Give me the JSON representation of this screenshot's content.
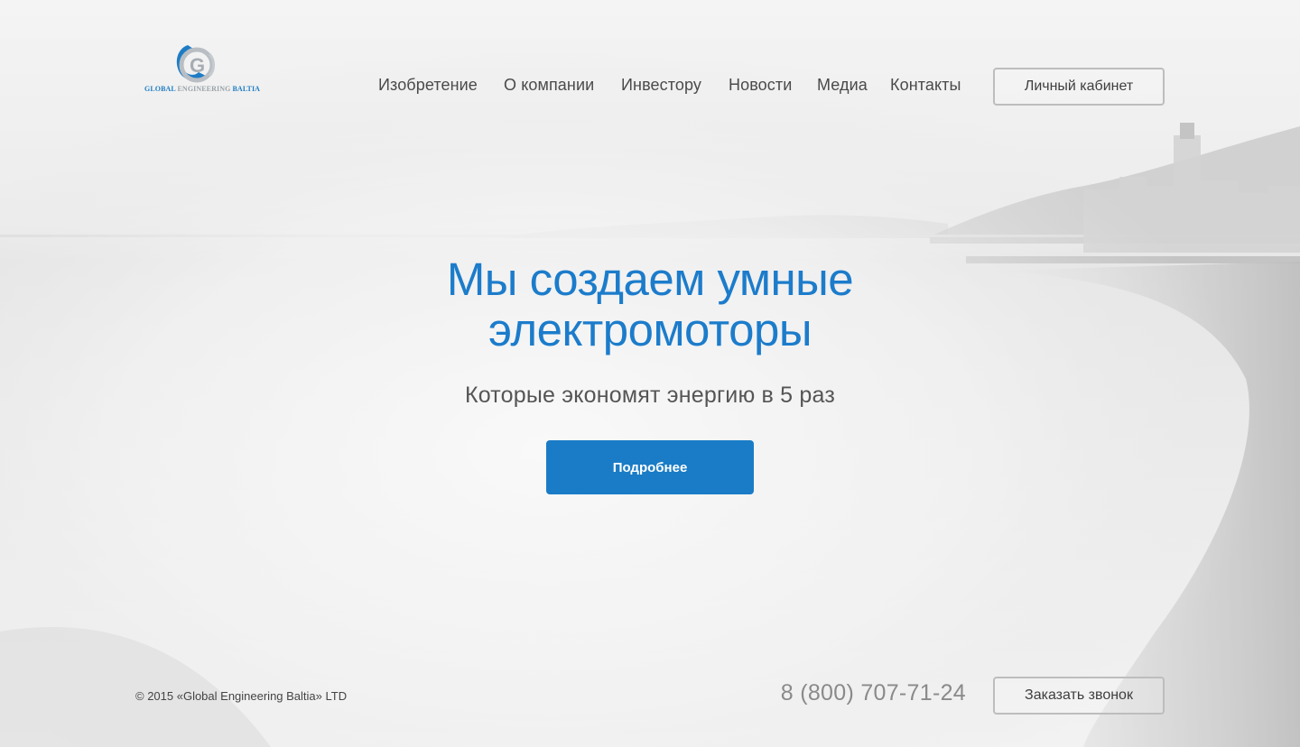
{
  "logo": {
    "icon": "global-engineering-baltia-logo",
    "text_blue": "GLOBAL ",
    "text_grey": "ENGINEERING ",
    "text_blue2": "BALTIA",
    "colors": {
      "blue": "#1e7cc4",
      "grey": "#9aa2a8"
    }
  },
  "nav": {
    "items": [
      {
        "label": "Изобретение"
      },
      {
        "label": "О компании"
      },
      {
        "label": "Инвестору"
      },
      {
        "label": "Новости"
      },
      {
        "label": "Медиа"
      },
      {
        "label": "Контакты"
      }
    ],
    "cabinet_label": "Личный кабинет"
  },
  "hero": {
    "title_line1": "Мы создаем умные",
    "title_line2": "электромоторы",
    "subtitle": "Которые экономят энергию в 5 раз",
    "button_label": "Подробнее"
  },
  "footer": {
    "copyright": "© 2015 «Global Engineering Baltia» LTD",
    "phone": "8 (800) 707-71-24",
    "call_button_label": "Заказать звонок"
  },
  "colors": {
    "accent": "#1a7cc6",
    "title": "#1c7ccb",
    "text": "#4a4a4a",
    "outline": "#bdbdbd"
  }
}
